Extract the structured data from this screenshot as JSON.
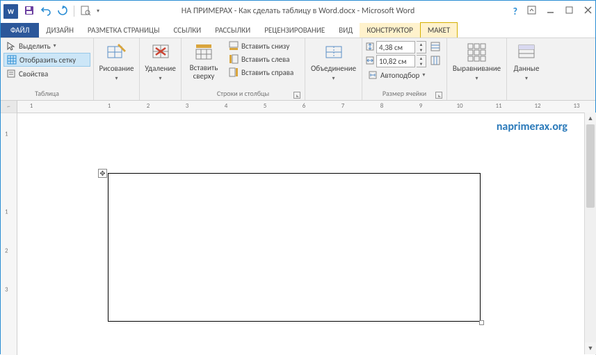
{
  "title": "НА ПРИМЕРАХ - Как сделать таблицу в Word.docx - Microsoft Word",
  "tabs": {
    "file": "ФАЙЛ",
    "design": "ДИЗАЙН",
    "layout": "РАЗМЕТКА СТРАНИЦЫ",
    "refs": "ССЫЛКИ",
    "mailings": "РАССЫЛКИ",
    "review": "РЕЦЕНЗИРОВАНИЕ",
    "view": "ВИД",
    "constructor": "КОНСТРУКТОР",
    "maket": "МАКЕТ"
  },
  "ribbon": {
    "table_group": {
      "label": "Таблица",
      "select": "Выделить",
      "grid": "Отобразить сетку",
      "props": "Свойства"
    },
    "draw_group": {
      "draw": "Рисование"
    },
    "delete_group": {
      "delete": "Удаление"
    },
    "rows_cols": {
      "label": "Строки и столбцы",
      "insert_top": "Вставить сверху",
      "insert_below": "Вставить снизу",
      "insert_left": "Вставить слева",
      "insert_right": "Вставить справа"
    },
    "merge": {
      "label": "Объединение"
    },
    "size": {
      "label": "Размер ячейки",
      "height": "4,38 см",
      "width": "10,82 см",
      "autofit": "Автоподбор"
    },
    "align": {
      "label": "Выравнивание"
    },
    "data": {
      "label": "Данные"
    }
  },
  "ruler": {
    "marks": [
      "1",
      "",
      "1",
      "2",
      "3",
      "4",
      "5",
      "6",
      "7",
      "8",
      "9",
      "10",
      "11",
      "12",
      "13"
    ]
  },
  "vruler": [
    "1",
    "",
    "1",
    "2",
    "3"
  ],
  "watermark": "naprimerax.org"
}
